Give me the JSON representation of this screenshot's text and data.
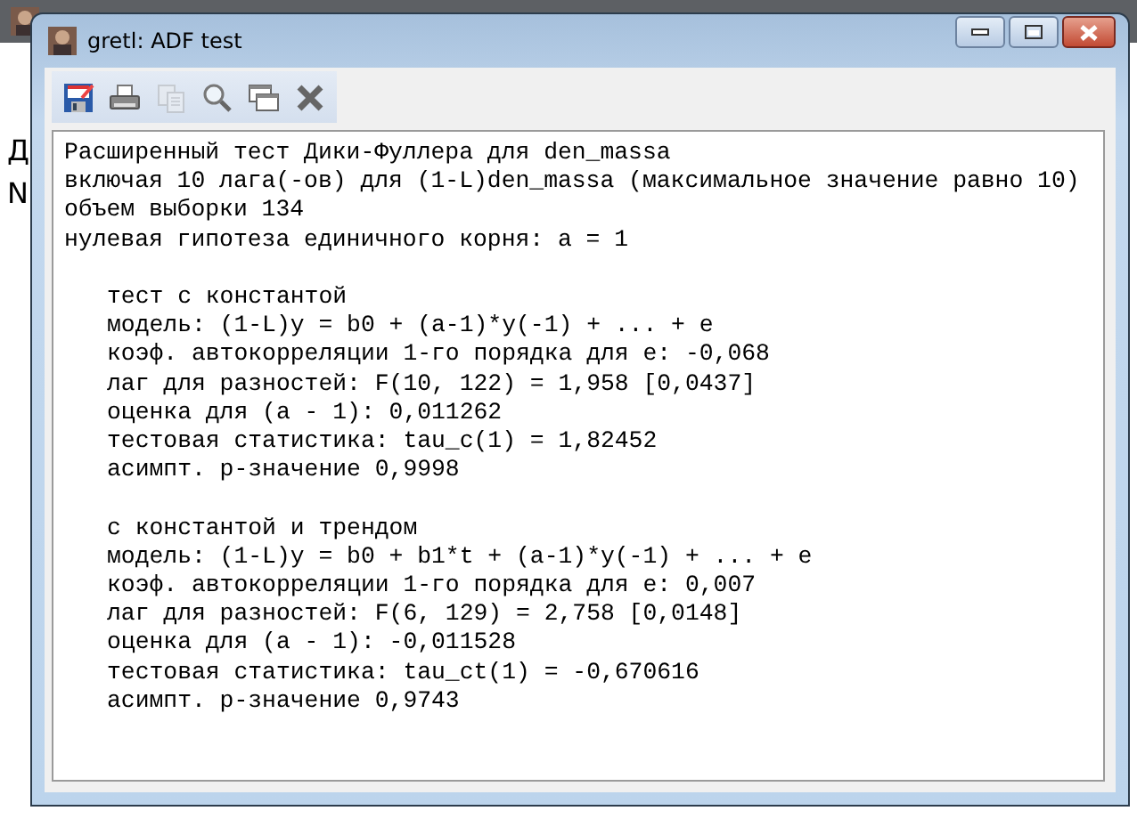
{
  "background_window": {
    "labels": [
      "Д",
      "N"
    ]
  },
  "window": {
    "title": "gretl: ADF test"
  },
  "toolbar": [
    {
      "kind": "save",
      "disabled": false
    },
    {
      "kind": "print",
      "disabled": false
    },
    {
      "kind": "copy",
      "disabled": true
    },
    {
      "kind": "find",
      "disabled": false
    },
    {
      "kind": "windows",
      "disabled": false
    },
    {
      "kind": "close",
      "disabled": false
    }
  ],
  "output": {
    "header": [
      "Расширенный тест Дики-Фуллера для den_massa",
      "включая 10 лага(-ов) для (1-L)den_massa (максимальное значение равно 10)",
      "объем выборки 134",
      "нулевая гипотеза единичного корня: a = 1"
    ],
    "sections": [
      {
        "title": "тест с константой",
        "lines": [
          "модель: (1-L)y = b0 + (a-1)*y(-1) + ... + e",
          "коэф. автокорреляции 1-го порядка для e: -0,068",
          "лаг для разностей: F(10, 122) = 1,958 [0,0437]",
          "оценка для (a - 1): 0,011262",
          "тестовая статистика: tau_c(1) = 1,82452",
          "асимпт. р-значение 0,9998"
        ]
      },
      {
        "title": "с константой и трендом",
        "lines": [
          "модель: (1-L)y = b0 + b1*t + (a-1)*y(-1) + ... + e",
          "коэф. автокорреляции 1-го порядка для e: 0,007",
          "лаг для разностей: F(6, 129) = 2,758 [0,0148]",
          "оценка для (a - 1): -0,011528",
          "тестовая статистика: tau_ct(1) = -0,670616",
          "асимпт. р-значение 0,9743"
        ]
      }
    ]
  }
}
